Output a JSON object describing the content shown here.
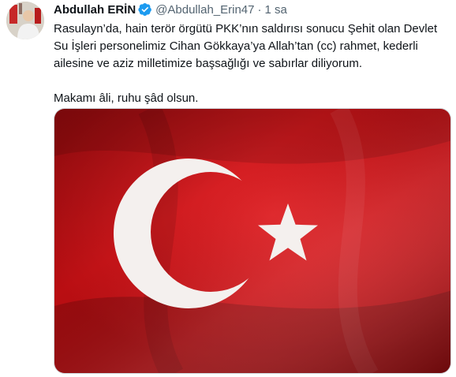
{
  "tweet": {
    "author_name": "Abdullah ERİN",
    "verified_icon": "verified-badge-icon",
    "handle": "@Abdullah_Erin47",
    "separator": "·",
    "time": "1 sa",
    "text_paragraph_1": "Rasulayn’da, hain terör örgütü PKK’nın saldırısı sonucu Şehit olan Devlet Su İşleri personelimiz Cihan Gökkaya’ya Allah’tan (cc) rahmet, kederli ailesine ve aziz milletimize başsağlığı ve sabırlar diliyorum.",
    "text_paragraph_2": "Makamı âli, ruhu şâd olsun.",
    "media": {
      "icon": "turkish-flag-image",
      "flag_red": "#d4141a",
      "emblem_white": "#f4f0ee"
    }
  },
  "colors": {
    "text_primary": "#0f1419",
    "text_secondary": "#536471",
    "verified_blue": "#1d9bf0"
  }
}
